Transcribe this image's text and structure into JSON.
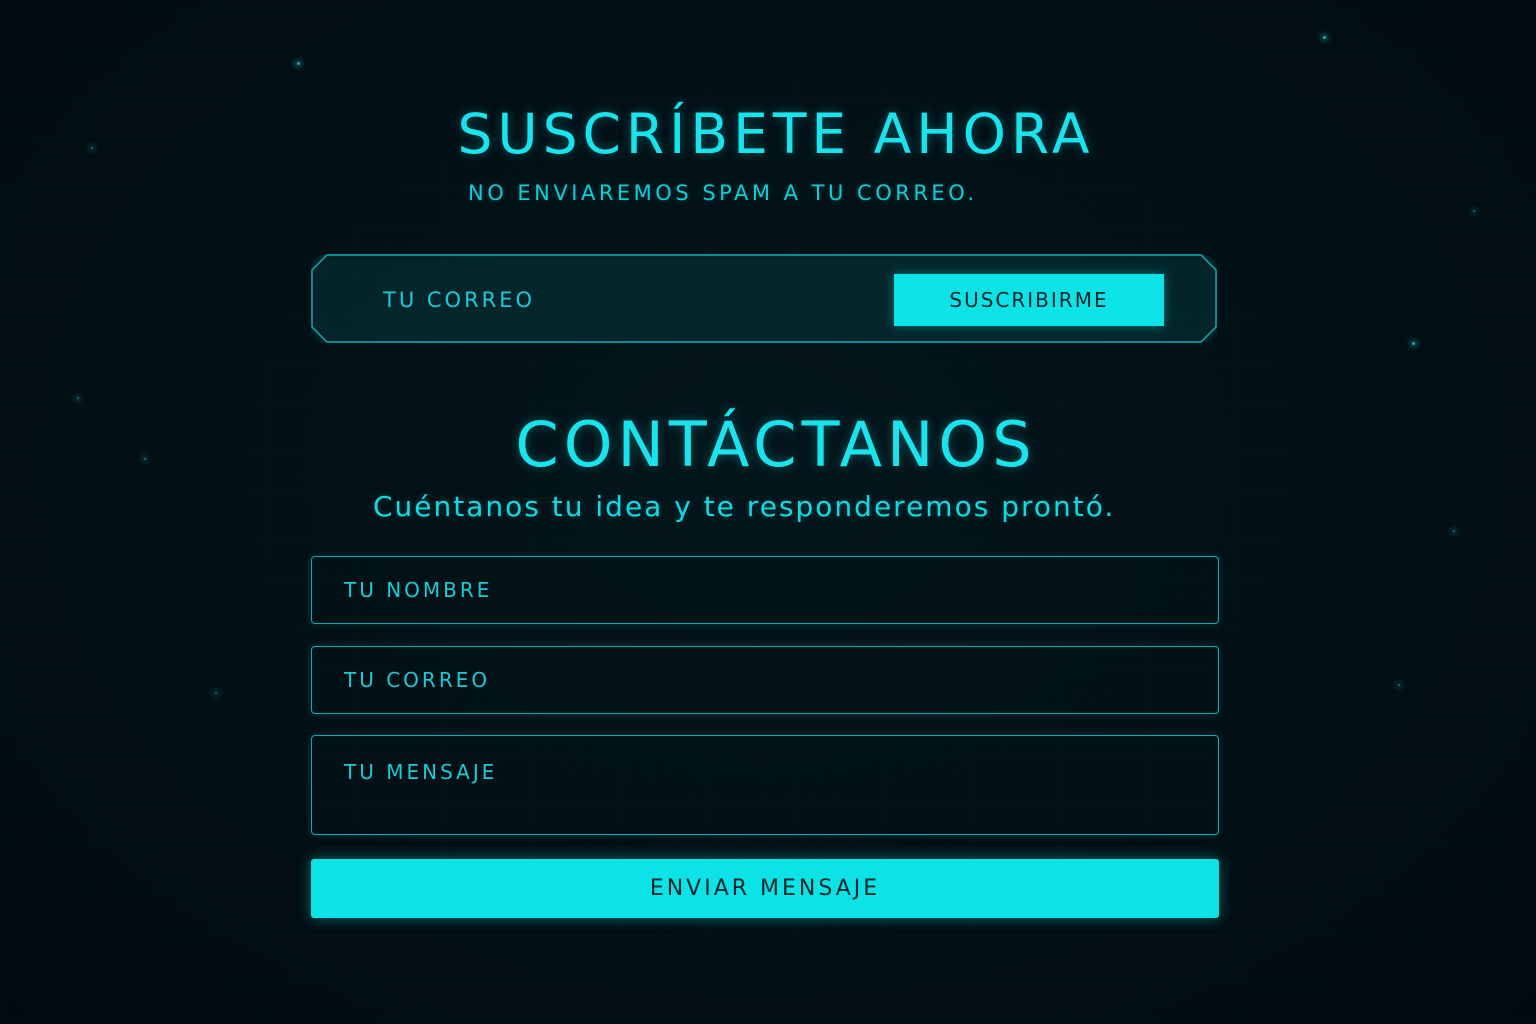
{
  "colors": {
    "accent": "#0ce3e6",
    "text_cyan": "#19e3ec",
    "background": "#021116",
    "button_text": "#04262a"
  },
  "newsletter": {
    "title": "SUSCRÍBETE AHORA",
    "subtitle": "NO ENVIAREMOS SPAM A TU CORREO.",
    "email_placeholder": "TU CORREO",
    "submit_label": "SUSCRIBIRME"
  },
  "contact": {
    "title": "CONTÁCTANOS",
    "subtitle": "Cuéntanos tu idea y te responderemos prontó.",
    "name_placeholder": "TU NOMBRE",
    "email_placeholder": "TU CORREO",
    "message_placeholder": "TU MENSAJE",
    "submit_label": "ENVIAR MENSAJE"
  }
}
